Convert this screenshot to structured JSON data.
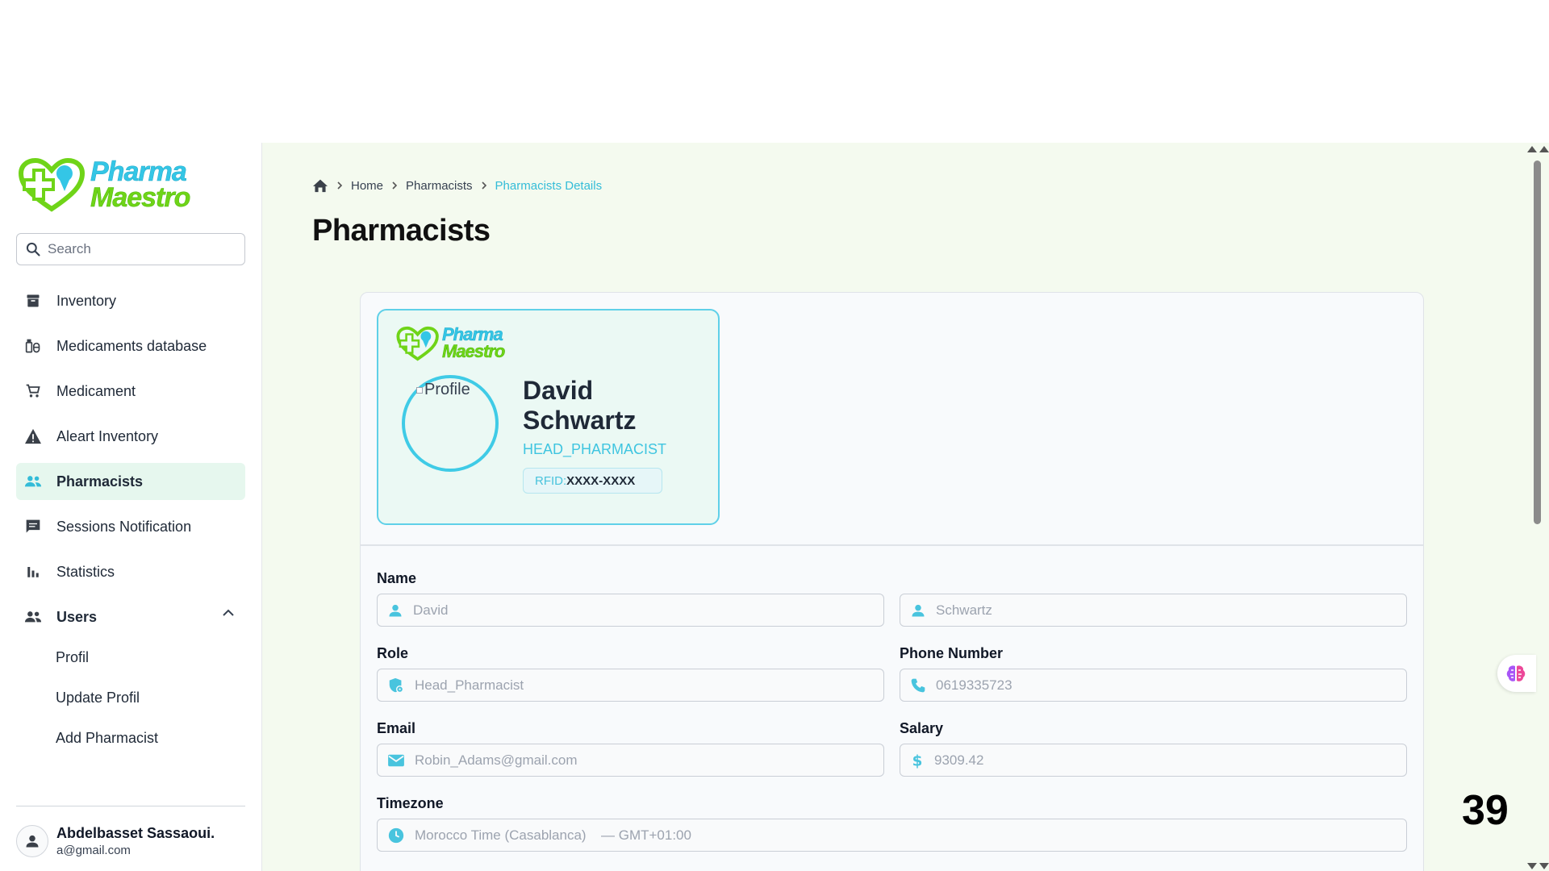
{
  "brand": {
    "line1": "Pharma",
    "line2": "Maestro"
  },
  "search": {
    "placeholder": "Search"
  },
  "sidebar": {
    "items": [
      {
        "label": "Inventory",
        "icon": "archive-icon"
      },
      {
        "label": "Medicaments database",
        "icon": "pills-icon"
      },
      {
        "label": "Medicament",
        "icon": "cart-icon"
      },
      {
        "label": "Aleart Inventory",
        "icon": "warning-icon"
      },
      {
        "label": "Pharmacists",
        "icon": "group-icon",
        "active": true
      },
      {
        "label": "Sessions Notification",
        "icon": "chat-icon"
      },
      {
        "label": "Statistics",
        "icon": "bar-chart-icon"
      }
    ],
    "users": {
      "label": "Users",
      "children": [
        "Profil",
        "Update Profil",
        "Add Pharmacist"
      ]
    }
  },
  "user": {
    "name": "Abdelbasset Sassaoui.",
    "email": "a@gmail.com"
  },
  "breadcrumb": {
    "home": "Home",
    "section": "Pharmacists",
    "current": "Pharmacists Details"
  },
  "page": {
    "title": "Pharmacists"
  },
  "id_card": {
    "profile_alt": "Profile",
    "first_name": "David",
    "last_name": "Schwartz",
    "role": "HEAD_PHARMACIST",
    "rfid_label": "RFID:",
    "rfid_value": "XXXX-XXXX"
  },
  "form": {
    "name_label": "Name",
    "first_name_placeholder": "David",
    "last_name_placeholder": "Schwartz",
    "role_label": "Role",
    "role_placeholder": "Head_Pharmacist",
    "phone_label": "Phone Number",
    "phone_placeholder": "0619335723",
    "email_label": "Email",
    "email_placeholder": "Robin_Adams@gmail.com",
    "salary_label": "Salary",
    "salary_placeholder": "9309.42",
    "timezone_label": "Timezone",
    "timezone_placeholder": "Morocco Time (Casablanca)",
    "timezone_offset": "— GMT+01:00"
  },
  "overlay": {
    "counter": "39"
  },
  "colors": {
    "accent": "#3fc5e0",
    "brand_green": "#6fd418",
    "main_bg": "#f4faef",
    "active_bg": "#e6f7ee"
  }
}
